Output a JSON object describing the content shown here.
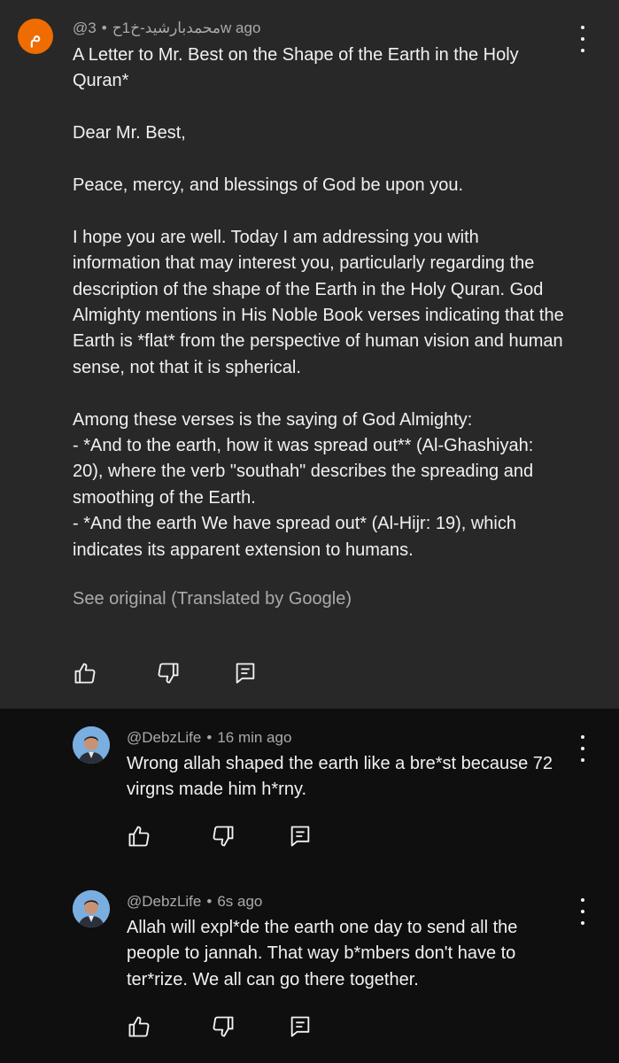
{
  "top_comment": {
    "avatar_letter": "م",
    "author": "@محمدبارشيد-خ1ح",
    "time": "3w ago",
    "paragraphs": [
      [
        "A Letter to Mr. Best on the Shape of the Earth in the Holy",
        "Quran*"
      ],
      [
        "Dear Mr. Best,"
      ],
      [
        "Peace, mercy, and blessings of God be upon you."
      ],
      [
        "I hope you are well. Today I am addressing you with",
        "information that may interest you, particularly regarding the",
        "description of the shape of the Earth in the Holy Quran. God",
        "Almighty mentions in His Noble Book verses indicating that the",
        "Earth is *flat* from the perspective of human vision and human",
        "sense, not that it is spherical."
      ],
      [
        "Among these verses is the saying of God Almighty:",
        "- *And to the earth, how it was spread out** (Al-Ghashiyah:",
        "20), where the verb \"southah\" describes the spreading and",
        "smoothing of the Earth.",
        "- *And the earth We have spread out* (Al-Hijr: 19), which",
        "indicates its apparent extension to humans."
      ]
    ],
    "see_original": "See original (Translated by Google)"
  },
  "replies": [
    {
      "author": "@DebzLife",
      "time": "16 min ago",
      "lines": [
        "Wrong allah shaped the earth like a bre*st because 72",
        "virgns made him h*rny."
      ]
    },
    {
      "author": "@DebzLife",
      "time": "6s ago",
      "lines": [
        "Allah will expl*de the earth one day to send all the",
        "people to jannah. That way b*mbers don't have to",
        "ter*rize. We all can go there together."
      ]
    }
  ],
  "icons": {
    "like": "thumbs-up-icon",
    "dislike": "thumbs-down-icon",
    "reply": "reply-icon",
    "more": "more-vertical-icon"
  },
  "colors": {
    "top_comment_bg": "#282828",
    "page_bg": "#0f0f0f",
    "avatar_bg": "#ef6c00",
    "secondary_text": "#aaaaaa"
  }
}
